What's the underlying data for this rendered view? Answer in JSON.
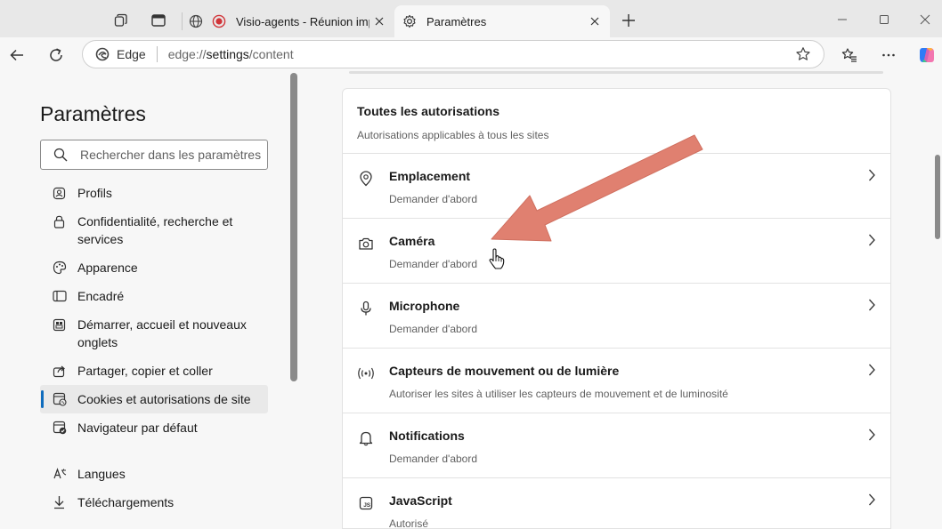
{
  "tabs": {
    "inactive_title": "Visio-agents - Réunion impromptue",
    "active_title": "Paramètres"
  },
  "address": {
    "edge_label": "Edge",
    "url_prefix": "edge://",
    "url_host": "settings",
    "url_path": "/content"
  },
  "sidebar": {
    "title": "Paramètres",
    "search_placeholder": "Rechercher dans les paramètres",
    "items": [
      {
        "label": "Profils",
        "icon": "profile-icon"
      },
      {
        "label": "Confidentialité, recherche et services",
        "icon": "lock-icon"
      },
      {
        "label": "Apparence",
        "icon": "palette-icon"
      },
      {
        "label": "Encadré",
        "icon": "sidebar-icon"
      },
      {
        "label": "Démarrer, accueil et nouveaux onglets",
        "icon": "home-grid-icon"
      },
      {
        "label": "Partager, copier et coller",
        "icon": "share-icon"
      },
      {
        "label": "Cookies et autorisations de site",
        "icon": "cookies-icon",
        "selected": true
      },
      {
        "label": "Navigateur par défaut",
        "icon": "default-browser-icon"
      },
      {
        "label": "Langues",
        "icon": "languages-icon"
      },
      {
        "label": "Téléchargements",
        "icon": "download-icon"
      }
    ]
  },
  "permissions": {
    "title": "Toutes les autorisations",
    "subtitle": "Autorisations applicables à tous les sites",
    "rows": [
      {
        "title": "Emplacement",
        "status": "Demander d'abord",
        "icon": "location-icon"
      },
      {
        "title": "Caméra",
        "status": "Demander d'abord",
        "icon": "camera-icon"
      },
      {
        "title": "Microphone",
        "status": "Demander d'abord",
        "icon": "microphone-icon"
      },
      {
        "title": "Capteurs de mouvement ou de lumière",
        "status": "Autoriser les sites à utiliser les capteurs de mouvement et de luminosité",
        "icon": "sensors-icon"
      },
      {
        "title": "Notifications",
        "status": "Demander d'abord",
        "icon": "bell-icon"
      },
      {
        "title": "JavaScript",
        "status": "Autorisé",
        "icon": "javascript-icon"
      }
    ]
  },
  "colors": {
    "accent": "#0f6cbd",
    "annotation_arrow": "#e08070",
    "record_red": "#d13438"
  }
}
